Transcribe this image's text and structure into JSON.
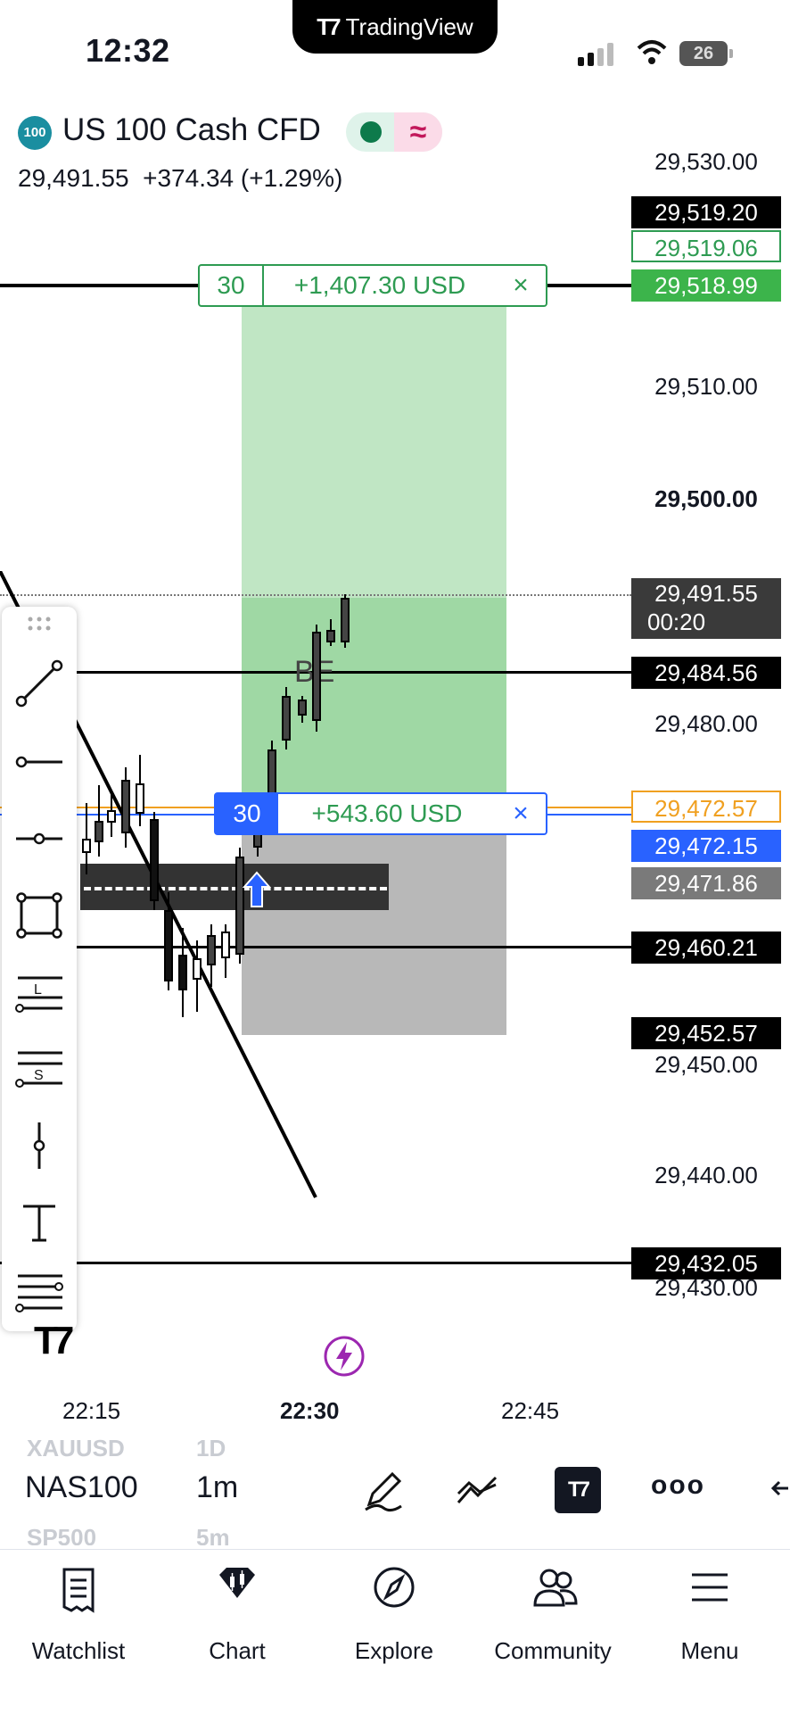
{
  "status_bar": {
    "time": "12:32",
    "app_pill": "TradingView",
    "battery": "26"
  },
  "symbol": {
    "badge": "100",
    "name": "US 100 Cash CFD",
    "price_line": "29,491.55  +374.34 (+1.29%)"
  },
  "price_axis": {
    "ticks": [
      "29,530.00",
      "29,510.00",
      "29,500.00",
      "29,480.00",
      "29,450.00",
      "29,440.00",
      "29,430.00"
    ],
    "labels": {
      "l1": "29,519.20",
      "l2": "29,519.06",
      "l3": "29,518.99",
      "current_price": "29,491.55",
      "countdown": "00:20",
      "be_line": "29,484.56",
      "entry_orange": "29,472.57",
      "entry_blue": "29,472.15",
      "entry_gray": "29,471.86",
      "line_460": "29,460.21",
      "stop": "29,452.57",
      "line_432": "29,432.05"
    }
  },
  "positions": {
    "take_profit": {
      "qty": "30",
      "pl": "+1,407.30 USD",
      "close": "×"
    },
    "open": {
      "qty": "30",
      "pl": "+543.60 USD",
      "close": "×"
    }
  },
  "chart_annotation": "BE",
  "time_axis": [
    "22:15",
    "22:30",
    "22:45"
  ],
  "bottom_bar": {
    "prev_symbol": "XAUUSD",
    "prev_interval": "1D",
    "symbol": "NAS100",
    "interval": "1m",
    "next_symbol": "SP500",
    "next_interval": "5m",
    "more": "ooo"
  },
  "nav": [
    {
      "label": "Watchlist",
      "icon": "watchlist-icon"
    },
    {
      "label": "Chart",
      "icon": "chart-icon"
    },
    {
      "label": "Explore",
      "icon": "explore-icon"
    },
    {
      "label": "Community",
      "icon": "community-icon"
    },
    {
      "label": "Menu",
      "icon": "menu-icon"
    }
  ],
  "colors": {
    "profit": "#2e9b52",
    "loss_zone": "#b5b5b5",
    "blue": "#2962ff",
    "orange": "#f0a020"
  }
}
